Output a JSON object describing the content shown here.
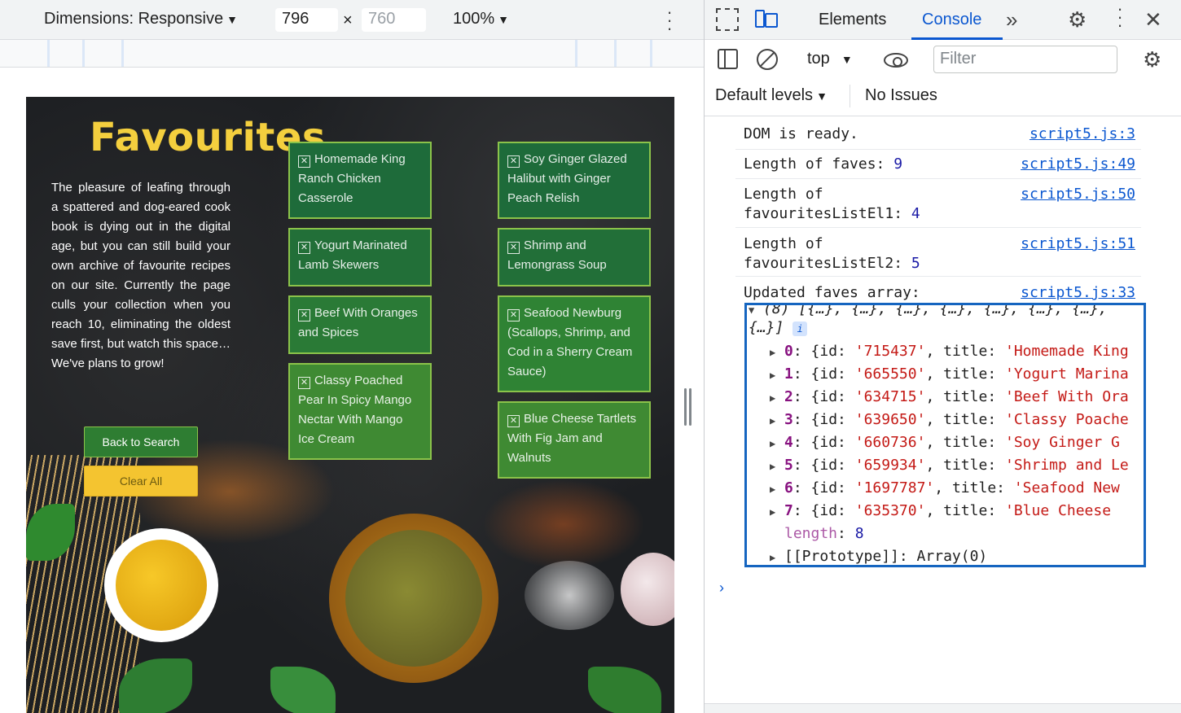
{
  "device_toolbar": {
    "dimensions_label": "Dimensions: Responsive",
    "width": "796",
    "height": "760",
    "times": "×",
    "zoom": "100%"
  },
  "webpage": {
    "title": "Favourites",
    "intro": "The pleasure of leafing through a spattered and dog-eared cook book is dying out in the digital age, but you can still build your own archive of favourite recipes on our site. Currently the page culls your collection when you reach 10, eliminating the oldest save first, but watch this space… We've plans to grow!",
    "back_button": "Back to Search",
    "clear_button": "Clear All",
    "favourites_col1": [
      "Homemade King Ranch Chicken Casserole",
      "Yogurt Marinated Lamb Skewers",
      "Beef With Oranges and Spices",
      "Classy Poached Pear In Spicy Mango Nectar With Mango Ice Cream"
    ],
    "favourites_col2": [
      "Soy Ginger Glazed Halibut with Ginger Peach Relish",
      "Shrimp and Lemongrass Soup",
      "Seafood Newburg (Scallops, Shrimp, and Cod in a Sherry Cream Sauce)",
      "Blue Cheese Tartlets With Fig Jam and Walnuts"
    ],
    "remove_icon": "☒"
  },
  "devtools": {
    "tabs": {
      "elements": "Elements",
      "console": "Console",
      "more": "»"
    },
    "context": "top",
    "filter_placeholder": "Filter",
    "levels": "Default levels",
    "issues": "No Issues",
    "logs": [
      {
        "text": "DOM is ready.",
        "value": "",
        "source": "script5.js:3"
      },
      {
        "text": "Length of faves:",
        "value": "9",
        "source": "script5.js:49"
      },
      {
        "text": "Length of favouritesListEl1:",
        "value": "4",
        "source": "script5.js:50"
      },
      {
        "text": "Length of favouritesListEl2:",
        "value": "5",
        "source": "script5.js:51"
      },
      {
        "text": "Updated faves array:",
        "value": "",
        "source": "script5.js:33"
      }
    ],
    "array_summary": "(8) [{…}, {…}, {…}, {…}, {…}, {…}, {…}, {…}]",
    "array_badge": "i",
    "array_entries": [
      {
        "index": "0",
        "id": "'715437'",
        "title": "'Homemade King"
      },
      {
        "index": "1",
        "id": "'665550'",
        "title": "'Yogurt Marina"
      },
      {
        "index": "2",
        "id": "'634715'",
        "title": "'Beef With Ora"
      },
      {
        "index": "3",
        "id": "'639650'",
        "title": "'Classy Poache"
      },
      {
        "index": "4",
        "id": "'660736'",
        "title": "'Soy Ginger G"
      },
      {
        "index": "5",
        "id": "'659934'",
        "title": "'Shrimp and Le"
      },
      {
        "index": "6",
        "id": "'1697787'",
        "title": "'Seafood New"
      },
      {
        "index": "7",
        "id": "'635370'",
        "title": "'Blue Cheese "
      }
    ],
    "length_key": "length",
    "length_value": "8",
    "prototype": "[[Prototype]]: Array(0)",
    "prompt": "›"
  }
}
